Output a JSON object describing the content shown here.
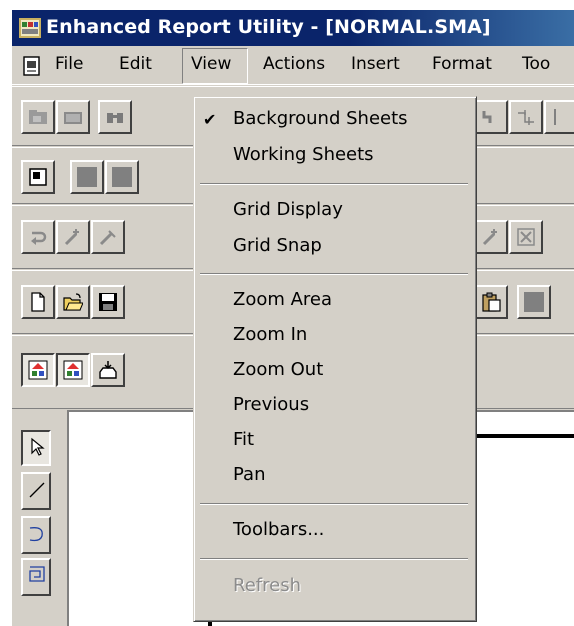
{
  "window": {
    "title": "Enhanced Report Utility - [NORMAL.SMA]",
    "icon": "app-icon"
  },
  "menubar": {
    "items": [
      {
        "label": "File"
      },
      {
        "label": "Edit"
      },
      {
        "label": "View"
      },
      {
        "label": "Actions"
      },
      {
        "label": "Insert"
      },
      {
        "label": "Format"
      },
      {
        "label": "Too"
      }
    ]
  },
  "view_menu": {
    "items": [
      {
        "label": "Background Sheets",
        "checked": true
      },
      {
        "label": "Working Sheets"
      },
      {
        "label": "Grid Display"
      },
      {
        "label": "Grid Snap"
      },
      {
        "label": "Zoom Area"
      },
      {
        "label": "Zoom In"
      },
      {
        "label": "Zoom Out"
      },
      {
        "label": "Previous"
      },
      {
        "label": "Fit"
      },
      {
        "label": "Pan"
      },
      {
        "label": "Toolbars..."
      },
      {
        "label": "Refresh",
        "disabled": true
      }
    ],
    "check_glyph": "✔"
  },
  "colors": {
    "title_bar": "#0a246a",
    "chrome": "#d4d0c8",
    "disabled_text": "#8c8c8c"
  }
}
